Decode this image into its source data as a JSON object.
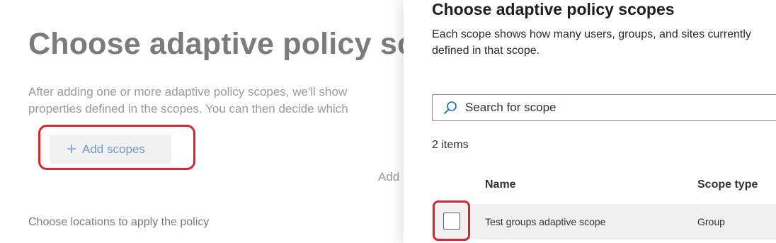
{
  "background": {
    "title": "Choose adaptive policy scopes",
    "description_line1": "After adding one or more adaptive policy scopes, we'll show",
    "description_line2": "properties defined in the scopes. You can then decide which",
    "add_scopes_label": "Add scopes",
    "add_text": "Add",
    "locations_heading": "Choose locations to apply the policy"
  },
  "panel": {
    "title": "Choose adaptive policy scopes",
    "description_line1": "Each scope shows how many users, groups, and sites currently",
    "description_line2": "defined in that scope.",
    "search_placeholder": "Search for scope",
    "item_count": "2 items",
    "columns": [
      "Name",
      "Scope type"
    ],
    "rows": [
      {
        "name": "Test groups adaptive scope",
        "scope_type": "Group",
        "checked": false
      }
    ]
  },
  "colors": {
    "highlight": "#d9252f",
    "link_blue": "#6e9ac9",
    "row_bg": "#f0f0f0"
  }
}
